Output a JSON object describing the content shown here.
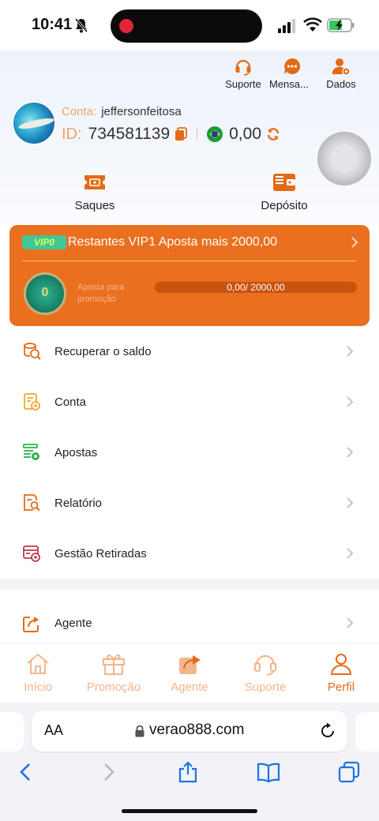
{
  "status_bar": {
    "time": "10:41"
  },
  "header": {
    "actions": [
      {
        "label": "Suporte",
        "icon": "headset-icon"
      },
      {
        "label": "Mensa...",
        "icon": "chat-icon"
      },
      {
        "label": "Dados",
        "icon": "user-settings-icon"
      }
    ],
    "account_label": "Conta:",
    "account_name": "jeffersonfeitosa",
    "id_label": "ID:",
    "id_value": "734581139",
    "balance": "0,00"
  },
  "quick_actions": {
    "saques": "Saques",
    "deposito": "Depósito"
  },
  "vip": {
    "badge": "VIP0",
    "text": "Restantes VIP1 Aposta mais 2000,00",
    "medal_level": "0",
    "sub_label": "Aposta para promoção",
    "progress_text": "0,00/ 2000,00",
    "progress_fraction": 0
  },
  "menu": {
    "items": [
      {
        "label": "Recuperar o saldo",
        "icon": "coin-recover-icon"
      },
      {
        "label": "Conta",
        "icon": "account-doc-icon"
      },
      {
        "label": "Apostas",
        "icon": "bets-list-icon"
      },
      {
        "label": "Relatório",
        "icon": "report-search-icon"
      },
      {
        "label": "Gestão Retiradas",
        "icon": "withdraw-manage-icon"
      }
    ],
    "agent_item": {
      "label": "Agente",
      "icon": "share-icon"
    }
  },
  "bottom_nav": {
    "items": [
      {
        "label": "Início",
        "icon": "home-icon"
      },
      {
        "label": "Promoção",
        "icon": "gift-icon"
      },
      {
        "label": "Agente",
        "icon": "share-icon"
      },
      {
        "label": "Suporte",
        "icon": "headset-icon"
      },
      {
        "label": "Perfil",
        "icon": "person-icon"
      }
    ],
    "active": "Perfil"
  },
  "browser": {
    "aa_label": "AA",
    "url": "verao888.com"
  },
  "colors": {
    "accent": "#ea6f1e",
    "accent_light": "#f3b58a",
    "vip_badge": "#43c695"
  }
}
